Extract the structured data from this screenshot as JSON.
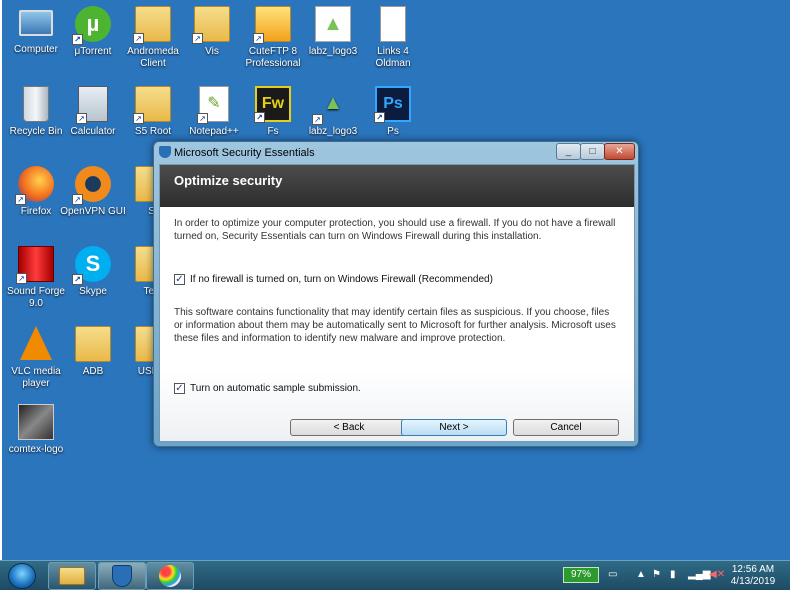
{
  "desktop": {
    "icons": [
      {
        "label": "Computer",
        "icon": "computer-icon"
      },
      {
        "label": "μTorrent",
        "icon": "utorrent-icon"
      },
      {
        "label": "Andromeda Client",
        "icon": "folder-icon"
      },
      {
        "label": "Vis",
        "icon": "folder-icon"
      },
      {
        "label": "CuteFTP 8 Professional",
        "icon": "cuteftp-icon"
      },
      {
        "label": "labz_logo3",
        "icon": "android-image-icon"
      },
      {
        "label": "Links 4 Oldman",
        "icon": "document-icon"
      },
      {
        "label": "Recycle Bin",
        "icon": "recycle-bin-icon"
      },
      {
        "label": "Calculator",
        "icon": "calculator-icon"
      },
      {
        "label": "S5 Root",
        "icon": "folder-icon"
      },
      {
        "label": "Notepad++",
        "icon": "notepadpp-icon"
      },
      {
        "label": "Fs",
        "icon": "fireworks-icon"
      },
      {
        "label": "labz_logo3",
        "icon": "android-image-icon"
      },
      {
        "label": "Ps",
        "icon": "photoshop-icon"
      },
      {
        "label": "Firefox",
        "icon": "firefox-icon"
      },
      {
        "label": "OpenVPN GUI",
        "icon": "openvpn-icon"
      },
      {
        "label": "St",
        "icon": "folder-icon"
      },
      {
        "label": "Sound Forge 9.0",
        "icon": "sound-forge-icon"
      },
      {
        "label": "Skype",
        "icon": "skype-icon"
      },
      {
        "label": "Tem",
        "icon": "folder-icon"
      },
      {
        "label": "VLC media player",
        "icon": "vlc-icon"
      },
      {
        "label": "ADB",
        "icon": "folder-icon"
      },
      {
        "label": "USB D",
        "icon": "folder-icon"
      },
      {
        "label": "comtex-logo",
        "icon": "image-icon"
      }
    ]
  },
  "window": {
    "title": "Microsoft Security Essentials",
    "header": "Optimize security",
    "intro": "In order to optimize your computer protection, you should use a firewall. If you do not have a firewall turned on, Security Essentials can turn on Windows Firewall during this installation.",
    "firewall_checkbox": {
      "label": "If no firewall is turned on, turn on Windows Firewall (Recommended)",
      "checked": true
    },
    "info": "This software contains functionality that may identify certain files as suspicious. If you choose, files or information about them may be automatically sent to Microsoft for further analysis. Microsoft uses these files and information to identify new malware and improve protection.",
    "sample_checkbox": {
      "label": "Turn on automatic sample submission.",
      "checked": true
    },
    "buttons": {
      "back": "< Back",
      "next": "Next >",
      "cancel": "Cancel"
    }
  },
  "taskbar": {
    "battery": "97%",
    "time": "12:56 AM",
    "date": "4/13/2019"
  }
}
